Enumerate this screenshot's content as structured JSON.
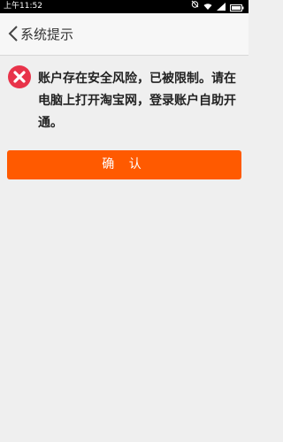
{
  "statusbar": {
    "time": "上午11:52"
  },
  "navbar": {
    "title": "系统提示"
  },
  "alert": {
    "message": "账户存在安全风险，已被限制。请在电脑上打开淘宝网，登录账户自助开通。"
  },
  "actions": {
    "confirm_label": "确 认"
  },
  "colors": {
    "accent": "#ff5a00",
    "error_icon": "#e8334a",
    "background": "#efefef"
  },
  "icons": {
    "back": "chevron-left-icon",
    "alert": "error-x-icon"
  }
}
